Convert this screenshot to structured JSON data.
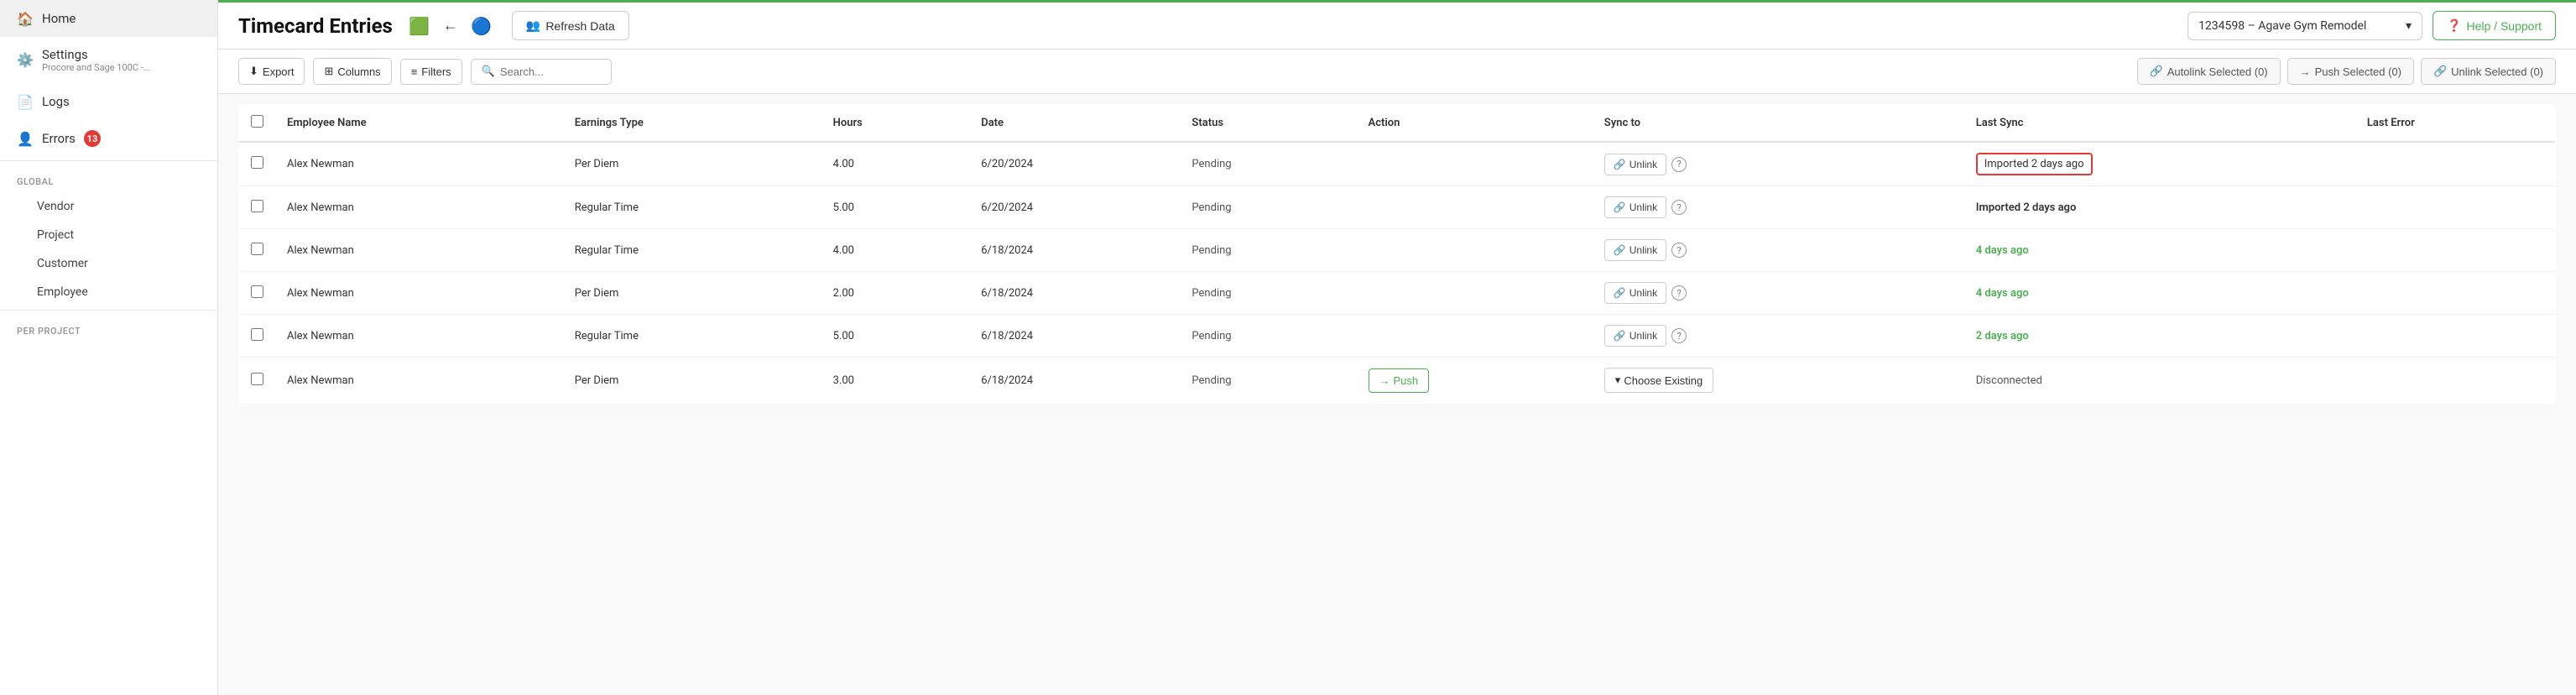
{
  "sidebar": {
    "home_label": "Home",
    "settings_label": "Settings",
    "settings_sub": "Procore and Sage 100C -...",
    "logs_label": "Logs",
    "errors_label": "Errors",
    "errors_badge": "13",
    "global_section": "GLOBAL",
    "global_items": [
      {
        "label": "Vendor"
      },
      {
        "label": "Project"
      },
      {
        "label": "Customer"
      },
      {
        "label": "Employee"
      }
    ],
    "per_project_section": "PER PROJECT"
  },
  "header": {
    "title": "Timecard Entries",
    "refresh_label": "Refresh Data",
    "project_selector": "1234598 – Agave Gym Remodel",
    "help_label": "Help / Support"
  },
  "toolbar": {
    "export_label": "Export",
    "columns_label": "Columns",
    "filters_label": "Filters",
    "search_placeholder": "Search...",
    "autolink_label": "Autolink Selected (0)",
    "push_selected_label": "Push Selected (0)",
    "unlink_selected_label": "Unlink Selected (0)"
  },
  "table": {
    "columns": [
      "Employee Name",
      "Earnings Type",
      "Hours",
      "Date",
      "Status",
      "Action",
      "Sync to",
      "Last Sync",
      "Last Error"
    ],
    "rows": [
      {
        "employee": "Alex Newman",
        "earnings": "Per Diem",
        "hours": "4.00",
        "date": "6/20/2024",
        "status": "Pending",
        "action": "",
        "sync_to": "unlink",
        "last_sync": "Imported 2 days ago",
        "last_sync_type": "highlight",
        "last_error": ""
      },
      {
        "employee": "Alex Newman",
        "earnings": "Regular Time",
        "hours": "5.00",
        "date": "6/20/2024",
        "status": "Pending",
        "action": "",
        "sync_to": "unlink",
        "last_sync": "Imported 2 days ago",
        "last_sync_type": "bold",
        "last_error": ""
      },
      {
        "employee": "Alex Newman",
        "earnings": "Regular Time",
        "hours": "4.00",
        "date": "6/18/2024",
        "status": "Pending",
        "action": "",
        "sync_to": "unlink",
        "last_sync": "4 days ago",
        "last_sync_type": "green",
        "last_error": ""
      },
      {
        "employee": "Alex Newman",
        "earnings": "Per Diem",
        "hours": "2.00",
        "date": "6/18/2024",
        "status": "Pending",
        "action": "",
        "sync_to": "unlink",
        "last_sync": "4 days ago",
        "last_sync_type": "green",
        "last_error": ""
      },
      {
        "employee": "Alex Newman",
        "earnings": "Regular Time",
        "hours": "5.00",
        "date": "6/18/2024",
        "status": "Pending",
        "action": "",
        "sync_to": "unlink",
        "last_sync": "2 days ago",
        "last_sync_type": "green",
        "last_error": ""
      },
      {
        "employee": "Alex Newman",
        "earnings": "Per Diem",
        "hours": "3.00",
        "date": "6/18/2024",
        "status": "Pending",
        "action": "push",
        "sync_to": "choose_existing",
        "last_sync": "Disconnected",
        "last_sync_type": "normal",
        "last_error": ""
      }
    ],
    "unlink_btn_label": "Unlink",
    "choose_existing_label": "Choose Existing",
    "push_label": "Push"
  }
}
